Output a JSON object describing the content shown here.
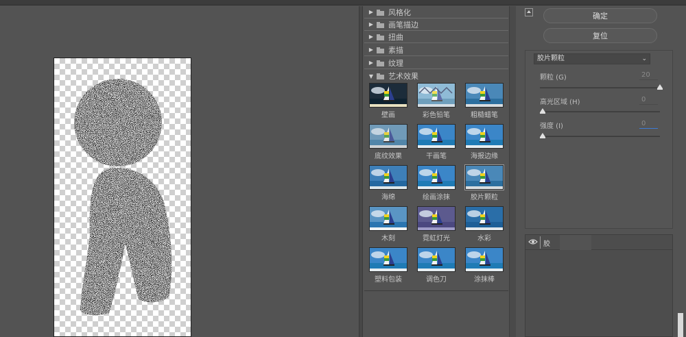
{
  "gallery": {
    "categories": [
      {
        "label": "风格化",
        "expanded": false
      },
      {
        "label": "画笔描边",
        "expanded": false
      },
      {
        "label": "扭曲",
        "expanded": false
      },
      {
        "label": "素描",
        "expanded": false
      },
      {
        "label": "纹理",
        "expanded": false
      },
      {
        "label": "艺术效果",
        "expanded": true
      }
    ],
    "filters": [
      {
        "label": "壁画",
        "style": "dark"
      },
      {
        "label": "彩色铅笔",
        "style": "sketch"
      },
      {
        "label": "粗糙蜡笔",
        "style": "grain"
      },
      {
        "label": "底纹效果",
        "style": "texture"
      },
      {
        "label": "干画笔",
        "style": "plain"
      },
      {
        "label": "海报边缘",
        "style": "plain"
      },
      {
        "label": "海绵",
        "style": "sponge"
      },
      {
        "label": "绘画涂抹",
        "style": "plain"
      },
      {
        "label": "胶片颗粒",
        "style": "grain"
      },
      {
        "label": "木刻",
        "style": "woodcut"
      },
      {
        "label": "霓虹灯光",
        "style": "neon"
      },
      {
        "label": "水彩",
        "style": "water"
      },
      {
        "label": "塑料包装",
        "style": "plain"
      },
      {
        "label": "调色刀",
        "style": "plain"
      },
      {
        "label": "涂抹棒",
        "style": "plain"
      }
    ],
    "selected": "胶片颗粒"
  },
  "controls": {
    "ok_label": "确定",
    "reset_label": "复位",
    "filter_select": "胶片颗粒",
    "params": [
      {
        "label": "颗粒 (G)",
        "value": "20",
        "level": 1.0
      },
      {
        "label": "高光区域 (H)",
        "value": "0",
        "level": 0.0
      },
      {
        "label": "强度 (I)",
        "value": "0",
        "level": 0.0
      }
    ]
  },
  "layers": {
    "layer_name": "胶"
  },
  "colors": {
    "background": "#535353",
    "panel": "#555555",
    "accent": "#3d7cd6"
  }
}
